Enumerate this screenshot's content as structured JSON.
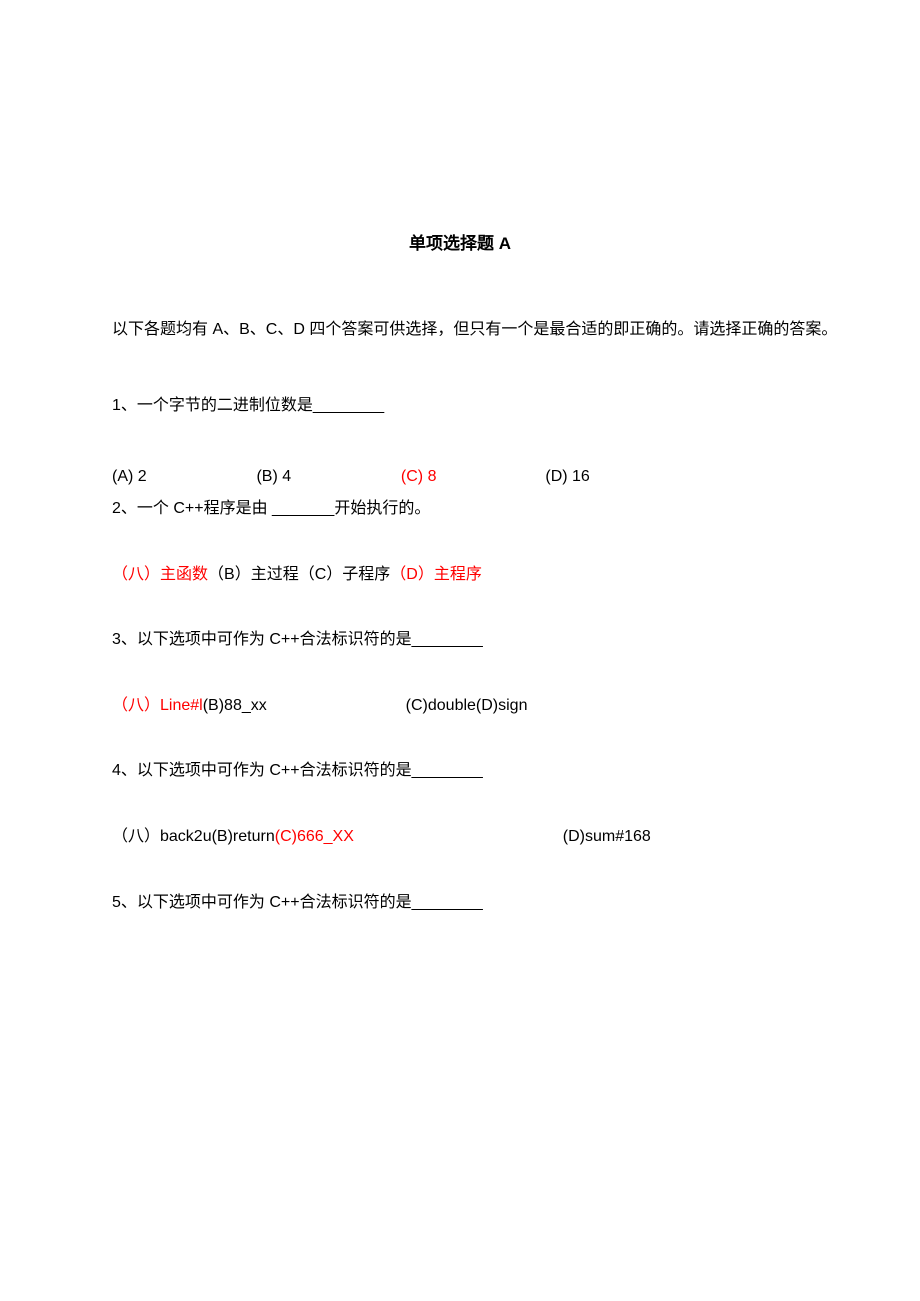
{
  "title": "单项选择题 A",
  "instructions": "以下各题均有 A、B、C、D 四个答案可供选择，但只有一个是最合适的即正确的。请选择正确的答案。",
  "q1": {
    "text": "1、一个字节的二进制位数是________",
    "a": "(A) 2",
    "b": "(B) 4",
    "c": "(C) 8",
    "d": "(D) 16"
  },
  "q2": {
    "text": "2、一个 C++程序是由  _______开始执行的。",
    "a_label": "（八）",
    "a_text": "主函数",
    "b": "（B）主过程",
    "c": "（C）子程序",
    "d_label": "（D）",
    "d_text": "主程序"
  },
  "q3": {
    "text": "3、以下选项中可作为 C++合法标识符的是________",
    "a_label": "（八）",
    "a_text": "Line#l",
    "b": "(B)88_xx",
    "cd": "(C)double(D)sign"
  },
  "q4": {
    "text": "4、以下选项中可作为 C++合法标识符的是________",
    "ab": "（八）back2u(B)return",
    "c": "(C)666_XX",
    "d": "(D)sum#168"
  },
  "q5": {
    "text": "5、以下选项中可作为 C++合法标识符的是________"
  }
}
